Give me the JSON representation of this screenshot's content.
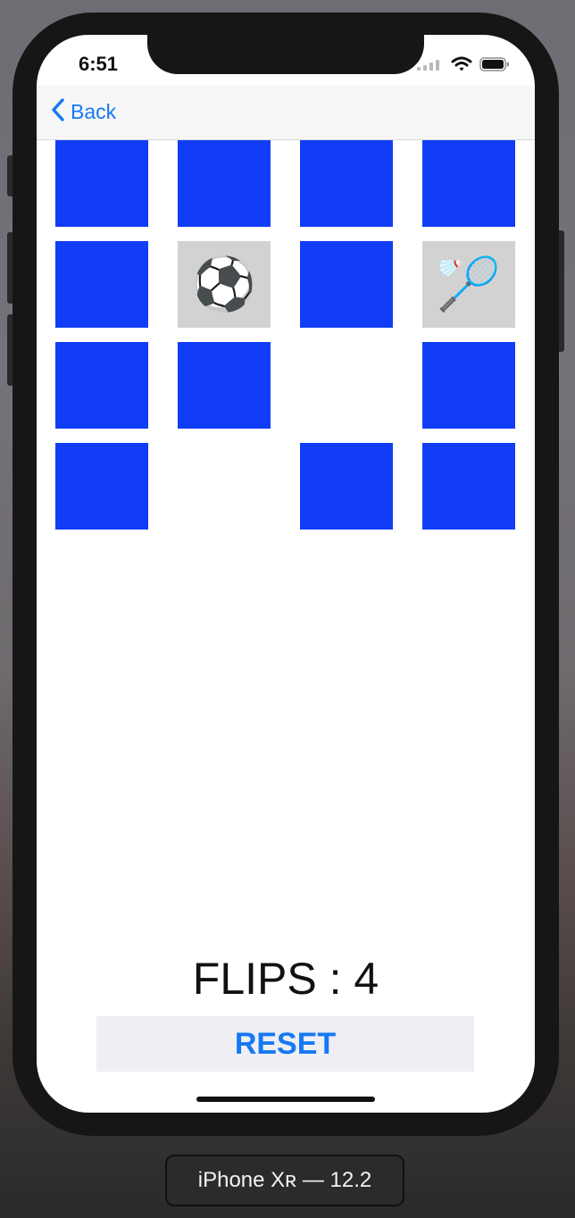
{
  "status_bar": {
    "time": "6:51"
  },
  "nav": {
    "back_label": "Back"
  },
  "cards": [
    {
      "state": "face-down",
      "emoji": ""
    },
    {
      "state": "face-down",
      "emoji": ""
    },
    {
      "state": "face-down",
      "emoji": ""
    },
    {
      "state": "face-down",
      "emoji": ""
    },
    {
      "state": "face-down",
      "emoji": ""
    },
    {
      "state": "face-up",
      "emoji": "⚽"
    },
    {
      "state": "face-down",
      "emoji": ""
    },
    {
      "state": "face-up",
      "emoji": "🏸"
    },
    {
      "state": "face-down",
      "emoji": ""
    },
    {
      "state": "face-down",
      "emoji": ""
    },
    {
      "state": "matched",
      "emoji": ""
    },
    {
      "state": "face-down",
      "emoji": ""
    },
    {
      "state": "face-down",
      "emoji": ""
    },
    {
      "state": "matched",
      "emoji": ""
    },
    {
      "state": "face-down",
      "emoji": ""
    },
    {
      "state": "face-down",
      "emoji": ""
    }
  ],
  "colors": {
    "card_back": "#113df7",
    "card_face": "#d2d2d2",
    "tint": "#1678f2"
  },
  "score": {
    "flips_text": "FLIPS : 4"
  },
  "controls": {
    "reset_label": "RESET"
  },
  "simulator": {
    "device_label": "iPhone Xʀ — 12.2"
  }
}
